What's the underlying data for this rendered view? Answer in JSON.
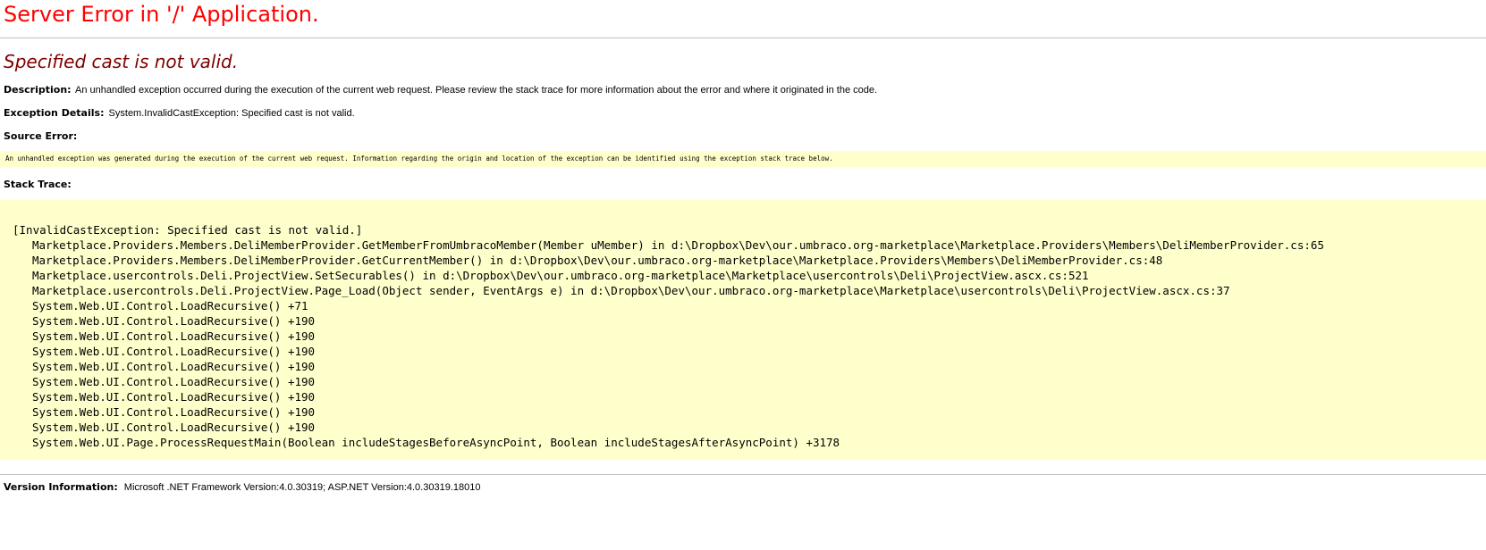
{
  "page": {
    "title": "Server Error in '/' Application.",
    "error_message": "Specified cast is not valid."
  },
  "description": {
    "label": "Description:",
    "text": "An unhandled exception occurred during the execution of the current web request. Please review the stack trace for more information about the error and where it originated in the code."
  },
  "exception_details": {
    "label": "Exception Details:",
    "text": "System.InvalidCastException: Specified cast is not valid."
  },
  "source_error": {
    "label": "Source Error:",
    "text": "An unhandled exception was generated during the execution of the current web request. Information regarding the origin and location of the exception can be identified using the exception stack trace below."
  },
  "stack_trace": {
    "label": "Stack Trace:",
    "header": "[InvalidCastException: Specified cast is not valid.]",
    "frames": [
      "Marketplace.Providers.Members.DeliMemberProvider.GetMemberFromUmbracoMember(Member uMember) in d:\\Dropbox\\Dev\\our.umbraco.org-marketplace\\Marketplace.Providers\\Members\\DeliMemberProvider.cs:65",
      "Marketplace.Providers.Members.DeliMemberProvider.GetCurrentMember() in d:\\Dropbox\\Dev\\our.umbraco.org-marketplace\\Marketplace.Providers\\Members\\DeliMemberProvider.cs:48",
      "Marketplace.usercontrols.Deli.ProjectView.SetSecurables() in d:\\Dropbox\\Dev\\our.umbraco.org-marketplace\\Marketplace\\usercontrols\\Deli\\ProjectView.ascx.cs:521",
      "Marketplace.usercontrols.Deli.ProjectView.Page_Load(Object sender, EventArgs e) in d:\\Dropbox\\Dev\\our.umbraco.org-marketplace\\Marketplace\\usercontrols\\Deli\\ProjectView.ascx.cs:37",
      "System.Web.UI.Control.LoadRecursive() +71",
      "System.Web.UI.Control.LoadRecursive() +190",
      "System.Web.UI.Control.LoadRecursive() +190",
      "System.Web.UI.Control.LoadRecursive() +190",
      "System.Web.UI.Control.LoadRecursive() +190",
      "System.Web.UI.Control.LoadRecursive() +190",
      "System.Web.UI.Control.LoadRecursive() +190",
      "System.Web.UI.Control.LoadRecursive() +190",
      "System.Web.UI.Control.LoadRecursive() +190",
      "System.Web.UI.Page.ProcessRequestMain(Boolean includeStagesBeforeAsyncPoint, Boolean includeStagesAfterAsyncPoint) +3178"
    ]
  },
  "version_info": {
    "label": "Version Information:",
    "text": "Microsoft .NET Framework Version:4.0.30319; ASP.NET Version:4.0.30319.18010"
  },
  "colors": {
    "title": "#ff0000",
    "error_message": "#800000",
    "code_background": "#ffffcc",
    "rule": "#c0c0c0"
  }
}
